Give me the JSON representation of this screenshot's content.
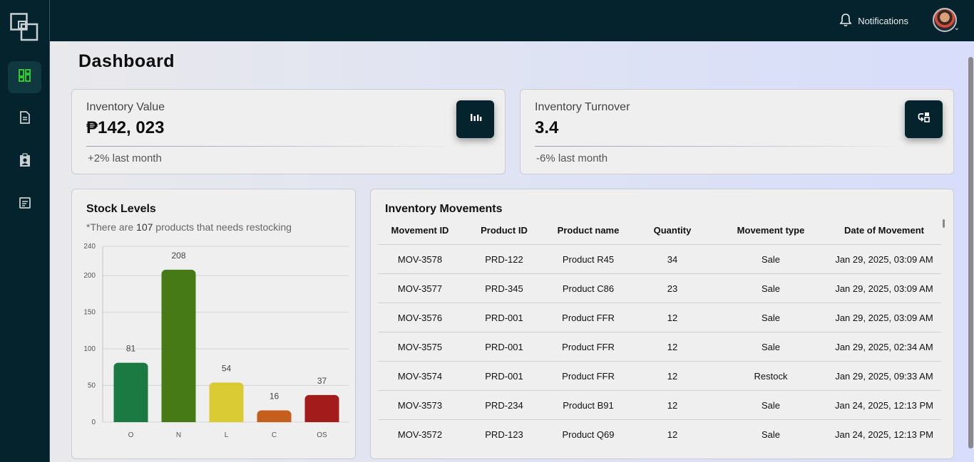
{
  "header": {
    "notifications_label": "Notifications"
  },
  "icons": {
    "logo": "squares-logo-icon",
    "nav": [
      "dashboard-icon",
      "document-icon",
      "badge-icon",
      "report-icon"
    ],
    "bell": "bell-icon",
    "kpi": [
      "bar-chart-icon",
      "turnover-icon"
    ]
  },
  "page": {
    "title": "Dashboard"
  },
  "kpis": [
    {
      "label": "Inventory Value",
      "value": "₱142, 023",
      "change": "+2% last month"
    },
    {
      "label": "Inventory Turnover",
      "value": "3.4",
      "change": "-6% last month"
    }
  ],
  "stock": {
    "title": "Stock Levels",
    "subtitle_prefix": "*There are ",
    "subtitle_count": "107",
    "subtitle_suffix": " products that needs restocking"
  },
  "chart_data": {
    "type": "bar",
    "categories": [
      "O",
      "N",
      "L",
      "C",
      "OS"
    ],
    "values": [
      81,
      208,
      54,
      16,
      37
    ],
    "colors": [
      "#1a7a42",
      "#467a17",
      "#dacb35",
      "#c55f1e",
      "#a31b1b"
    ],
    "ylim": [
      0,
      240
    ],
    "yticks": [
      0,
      50,
      100,
      150,
      200,
      240
    ],
    "grid": true,
    "title": "",
    "xlabel": "",
    "ylabel": ""
  },
  "movements": {
    "title": "Inventory Movements",
    "columns": [
      "Movement ID",
      "Product ID",
      "Product name",
      "Quantity",
      "Movement type",
      "Date of Movement"
    ],
    "rows": [
      [
        "MOV-3578",
        "PRD-122",
        "Product R45",
        "34",
        "Sale",
        "Jan 29, 2025, 03:09 AM"
      ],
      [
        "MOV-3577",
        "PRD-345",
        "Product C86",
        "23",
        "Sale",
        "Jan 29, 2025, 03:09 AM"
      ],
      [
        "MOV-3576",
        "PRD-001",
        "Product FFR",
        "12",
        "Sale",
        "Jan 29, 2025, 03:09 AM"
      ],
      [
        "MOV-3575",
        "PRD-001",
        "Product FFR",
        "12",
        "Sale",
        "Jan 29, 2025, 02:34 AM"
      ],
      [
        "MOV-3574",
        "PRD-001",
        "Product FFR",
        "12",
        "Restock",
        "Jan 29, 2025, 09:33 AM"
      ],
      [
        "MOV-3573",
        "PRD-234",
        "Product B91",
        "12",
        "Sale",
        "Jan 24, 2025, 12:13 PM"
      ],
      [
        "MOV-3572",
        "PRD-123",
        "Product Q69",
        "12",
        "Sale",
        "Jan 24, 2025, 12:13 PM"
      ]
    ]
  },
  "colors": {
    "sidebar": "#04232c",
    "accent_active": "#35d62c"
  }
}
